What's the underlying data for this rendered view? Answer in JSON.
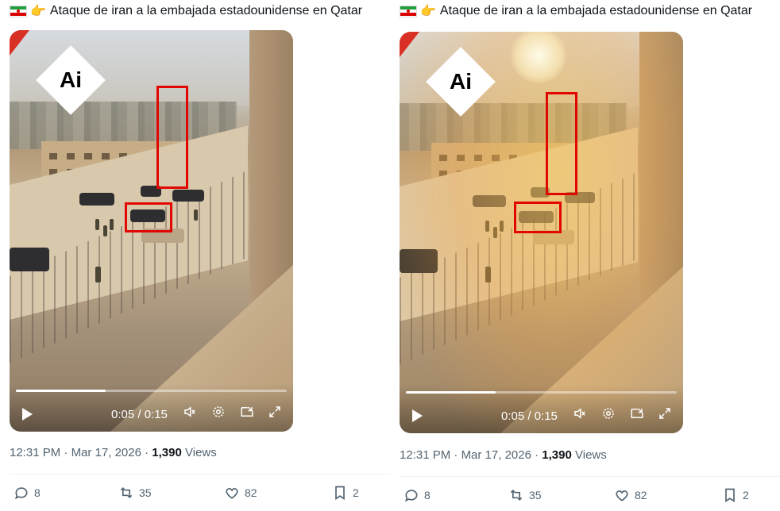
{
  "panels": [
    {
      "tweet_text": "Ataque de iran a la embajada estadounidense en Qatar",
      "ai_label": "Ai",
      "video": {
        "time": "0:05 / 0:15",
        "progress": 0.33
      },
      "meta": {
        "time": "12:31 PM",
        "date": "Mar 17, 2026",
        "views_count": "1,390",
        "views_label": "Views"
      },
      "actions": {
        "replies": "8",
        "reposts": "35",
        "likes": "82",
        "bookmarks": "2"
      }
    },
    {
      "tweet_text": "Ataque de iran a la embajada estadounidense en Qatar",
      "ai_label": "Ai",
      "video": {
        "time": "0:05 / 0:15",
        "progress": 0.33
      },
      "meta": {
        "time": "12:31 PM",
        "date": "Mar 17, 2026",
        "views_count": "1,390",
        "views_label": "Views"
      },
      "actions": {
        "replies": "8",
        "reposts": "35",
        "likes": "82",
        "bookmarks": "2"
      }
    }
  ],
  "separator": "·",
  "icons": {
    "flag": "iran-flag-icon",
    "pointer": "backhand-index-pointing-right-icon",
    "play": "play-icon",
    "volume": "volume-icon",
    "settings": "gear-icon",
    "pip": "picture-in-picture-icon",
    "fullscreen": "fullscreen-icon",
    "reply": "reply-icon",
    "repost": "repost-icon",
    "like": "heart-icon",
    "bookmark": "bookmark-icon"
  },
  "colors": {
    "ai_stripe": "#d93025",
    "highlight_box": "#e10600",
    "text_primary": "#0f1419",
    "text_secondary": "#536471"
  }
}
